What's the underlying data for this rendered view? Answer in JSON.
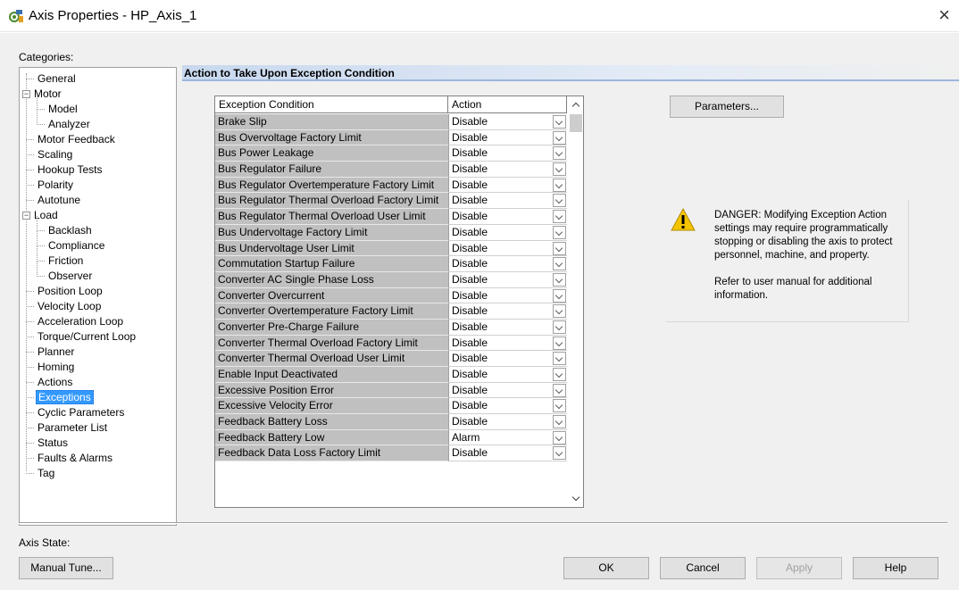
{
  "window": {
    "title": "Axis Properties - HP_Axis_1",
    "close_glyph": "×",
    "icon": "axis-properties-icon"
  },
  "categories": {
    "label": "Categories:",
    "items": [
      {
        "label": "General",
        "level": 1
      },
      {
        "label": "Motor",
        "level": 0,
        "expander": "−"
      },
      {
        "label": "Model",
        "level": 2
      },
      {
        "label": "Analyzer",
        "level": 2
      },
      {
        "label": "Motor Feedback",
        "level": 1
      },
      {
        "label": "Scaling",
        "level": 1
      },
      {
        "label": "Hookup Tests",
        "level": 1
      },
      {
        "label": "Polarity",
        "level": 1
      },
      {
        "label": "Autotune",
        "level": 1
      },
      {
        "label": "Load",
        "level": 0,
        "expander": "−"
      },
      {
        "label": "Backlash",
        "level": 2
      },
      {
        "label": "Compliance",
        "level": 2
      },
      {
        "label": "Friction",
        "level": 2
      },
      {
        "label": "Observer",
        "level": 2
      },
      {
        "label": "Position Loop",
        "level": 1
      },
      {
        "label": "Velocity Loop",
        "level": 1
      },
      {
        "label": "Acceleration Loop",
        "level": 1
      },
      {
        "label": "Torque/Current Loop",
        "level": 1
      },
      {
        "label": "Planner",
        "level": 1
      },
      {
        "label": "Homing",
        "level": 1
      },
      {
        "label": "Actions",
        "level": 1
      },
      {
        "label": "Exceptions",
        "level": 1,
        "selected": true
      },
      {
        "label": "Cyclic Parameters",
        "level": 1
      },
      {
        "label": "Parameter List",
        "level": 1
      },
      {
        "label": "Status",
        "level": 1
      },
      {
        "label": "Faults & Alarms",
        "level": 1
      },
      {
        "label": "Tag",
        "level": 1
      }
    ]
  },
  "section": {
    "title": "Action to Take Upon Exception Condition"
  },
  "exceptions_table": {
    "columns": [
      "Exception Condition",
      "Action"
    ],
    "rows": [
      {
        "condition": "Brake Slip",
        "action": "Disable"
      },
      {
        "condition": "Bus Overvoltage Factory Limit",
        "action": "Disable"
      },
      {
        "condition": "Bus Power Leakage",
        "action": "Disable"
      },
      {
        "condition": "Bus Regulator Failure",
        "action": "Disable"
      },
      {
        "condition": "Bus Regulator Overtemperature Factory Limit",
        "action": "Disable"
      },
      {
        "condition": "Bus Regulator Thermal Overload Factory Limit",
        "action": "Disable"
      },
      {
        "condition": "Bus Regulator Thermal Overload User Limit",
        "action": "Disable"
      },
      {
        "condition": "Bus Undervoltage Factory Limit",
        "action": "Disable"
      },
      {
        "condition": "Bus Undervoltage User Limit",
        "action": "Disable"
      },
      {
        "condition": "Commutation Startup Failure",
        "action": "Disable"
      },
      {
        "condition": "Converter AC Single Phase Loss",
        "action": "Disable"
      },
      {
        "condition": "Converter Overcurrent",
        "action": "Disable"
      },
      {
        "condition": "Converter Overtemperature Factory Limit",
        "action": "Disable"
      },
      {
        "condition": "Converter Pre-Charge Failure",
        "action": "Disable"
      },
      {
        "condition": "Converter Thermal Overload Factory Limit",
        "action": "Disable"
      },
      {
        "condition": "Converter Thermal Overload User Limit",
        "action": "Disable"
      },
      {
        "condition": "Enable Input Deactivated",
        "action": "Disable"
      },
      {
        "condition": "Excessive Position Error",
        "action": "Disable"
      },
      {
        "condition": "Excessive Velocity Error",
        "action": "Disable"
      },
      {
        "condition": "Feedback Battery Loss",
        "action": "Disable"
      },
      {
        "condition": "Feedback Battery Low",
        "action": "Alarm"
      },
      {
        "condition": "Feedback Data Loss Factory Limit",
        "action": "Disable"
      }
    ]
  },
  "parameters_button": {
    "label": "Parameters..."
  },
  "warning": {
    "icon": "warning-icon",
    "danger_text": "DANGER: Modifying Exception Action settings may require programmatically stopping or disabling the axis to protect personnel, machine, and property.",
    "refer_text": "Refer to user manual for additional information."
  },
  "footer": {
    "axis_state_label": "Axis State:",
    "manual_tune_label": "Manual Tune...",
    "ok_label": "OK",
    "cancel_label": "Cancel",
    "apply_label": "Apply",
    "help_label": "Help"
  },
  "colors": {
    "selection": "#3399ff",
    "header_gradient": "#c8d8ee",
    "condition_cell_bg": "#c0c0c0",
    "warning_yellow": "#f5c400"
  }
}
